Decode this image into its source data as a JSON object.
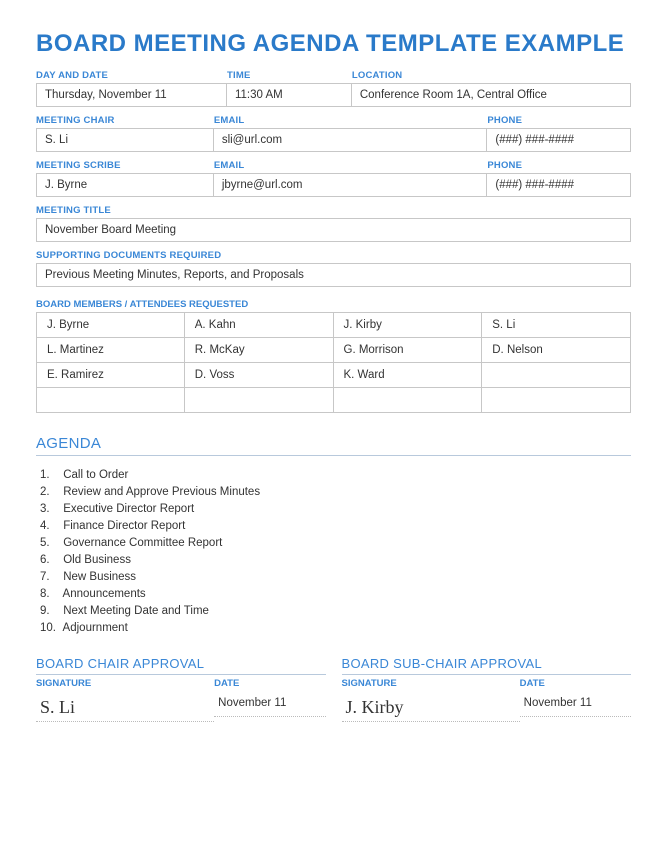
{
  "title": "BOARD MEETING AGENDA TEMPLATE EXAMPLE",
  "labels": {
    "day_date": "DAY AND DATE",
    "time": "TIME",
    "location": "LOCATION",
    "meeting_chair": "MEETING CHAIR",
    "email": "EMAIL",
    "phone": "PHONE",
    "meeting_scribe": "MEETING SCRIBE",
    "meeting_title": "MEETING TITLE",
    "supporting_docs": "SUPPORTING DOCUMENTS REQUIRED",
    "attendees": "BOARD MEMBERS / ATTENDEES REQUESTED",
    "agenda": "AGENDA",
    "chair_approval": "BOARD CHAIR APPROVAL",
    "subchair_approval": "BOARD SUB-CHAIR APPROVAL",
    "signature": "SIGNATURE",
    "date": "DATE"
  },
  "meeting": {
    "day_date": "Thursday, November 11",
    "time": "11:30 AM",
    "location": "Conference Room 1A, Central Office",
    "title": "November Board Meeting",
    "supporting_docs": "Previous Meeting Minutes, Reports, and Proposals"
  },
  "chair": {
    "name": "S. Li",
    "email": "sli@url.com",
    "phone": "(###) ###-####"
  },
  "scribe": {
    "name": "J. Byrne",
    "email": "jbyrne@url.com",
    "phone": "(###) ###-####"
  },
  "attendees": [
    "J. Byrne",
    "A. Kahn",
    "J. Kirby",
    "S. Li",
    "L. Martinez",
    "R. McKay",
    "G. Morrison",
    "D. Nelson",
    "E. Ramirez",
    "D. Voss",
    "K. Ward",
    "",
    "",
    "",
    "",
    ""
  ],
  "agenda_items": [
    "Call to Order",
    "Review and Approve Previous Minutes",
    "Executive Director Report",
    "Finance Director Report",
    "Governance Committee Report",
    "Old Business",
    "New Business",
    "Announcements",
    "Next Meeting Date and Time",
    "Adjournment"
  ],
  "approvals": {
    "chair": {
      "signature": "S. Li",
      "date": "November 11"
    },
    "subchair": {
      "signature": "J. Kirby",
      "date": "November 11"
    }
  }
}
